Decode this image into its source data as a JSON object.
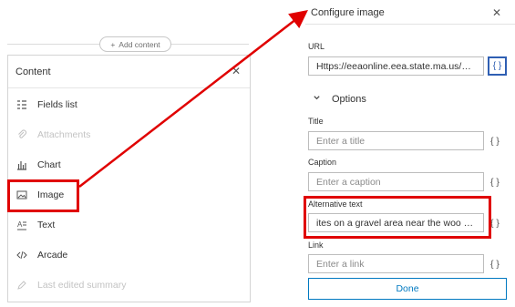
{
  "left": {
    "add_content_label": "Add content",
    "panel_title": "Content",
    "items": [
      {
        "label": "Fields list",
        "icon": "fields-list-icon",
        "disabled": false
      },
      {
        "label": "Attachments",
        "icon": "paperclip-icon",
        "disabled": true
      },
      {
        "label": "Chart",
        "icon": "chart-icon",
        "disabled": false
      },
      {
        "label": "Image",
        "icon": "image-icon",
        "disabled": false
      },
      {
        "label": "Text",
        "icon": "text-icon",
        "disabled": false
      },
      {
        "label": "Arcade",
        "icon": "code-icon",
        "disabled": false
      },
      {
        "label": "Last edited summary",
        "icon": "edit-icon",
        "disabled": true
      }
    ]
  },
  "right": {
    "title": "Configure image",
    "url_label": "URL",
    "url_value": "Https://eeaonline.eea.state.ma.us/…",
    "options_label": "Options",
    "title_label": "Title",
    "title_placeholder": "Enter a title",
    "caption_label": "Caption",
    "caption_placeholder": "Enter a caption",
    "alt_label": "Alternative text",
    "alt_value": "ites on a gravel area near the woo …",
    "link_label": "Link",
    "link_placeholder": "Enter a link",
    "braces": "{ }",
    "done_label": "Done"
  },
  "colors": {
    "highlight_red": "#e00000",
    "highlight_blue": "#2f5fb3",
    "accent": "#0079c1"
  }
}
